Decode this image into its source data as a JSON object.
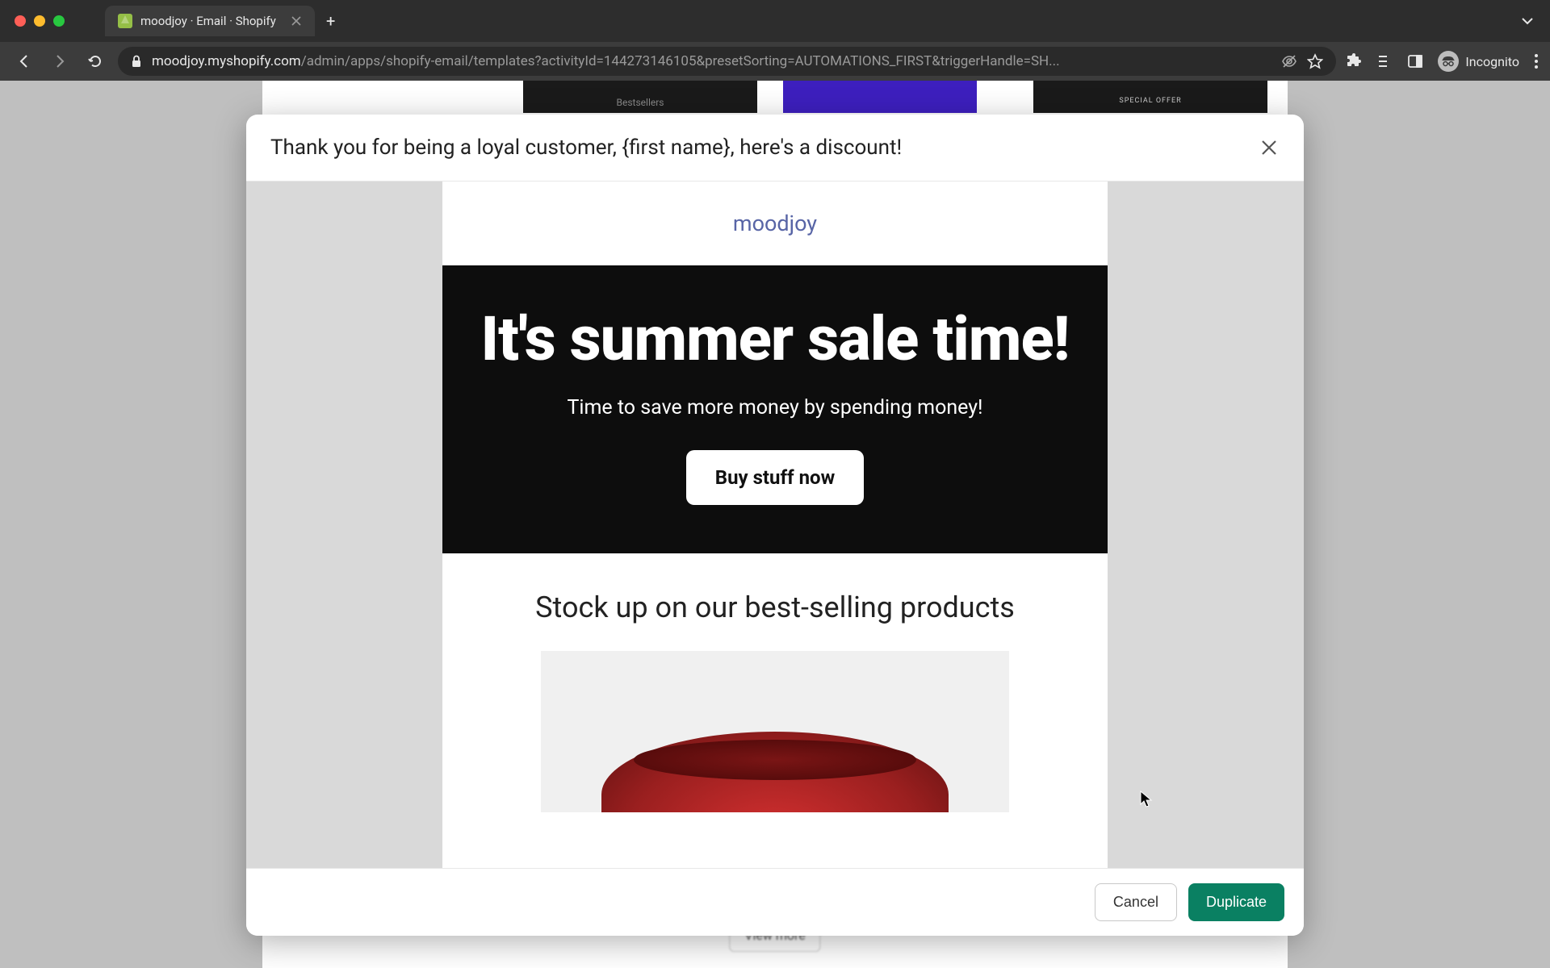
{
  "browser": {
    "tab_title": "moodjoy · Email · Shopify",
    "url_domain": "moodjoy.myshopify.com",
    "url_path": "/admin/apps/shopify-email/templates?activityId=144273146105&presetSorting=AUTOMATIONS_FIRST&triggerHandle=SH...",
    "incognito_label": "Incognito"
  },
  "background": {
    "template1_label": "Bestsellers",
    "template3_label": "SPECIAL OFFER",
    "view_more": "View more"
  },
  "modal": {
    "title": "Thank you for being a loyal customer, {first name}, here's a discount!",
    "buttons": {
      "cancel": "Cancel",
      "duplicate": "Duplicate"
    }
  },
  "email_preview": {
    "brand": "moodjoy",
    "hero_title": "It's summer sale time!",
    "hero_subtitle": "Time to save more money by spending money!",
    "cta_label": "Buy stuff now",
    "section_title": "Stock up on our best-selling products"
  }
}
